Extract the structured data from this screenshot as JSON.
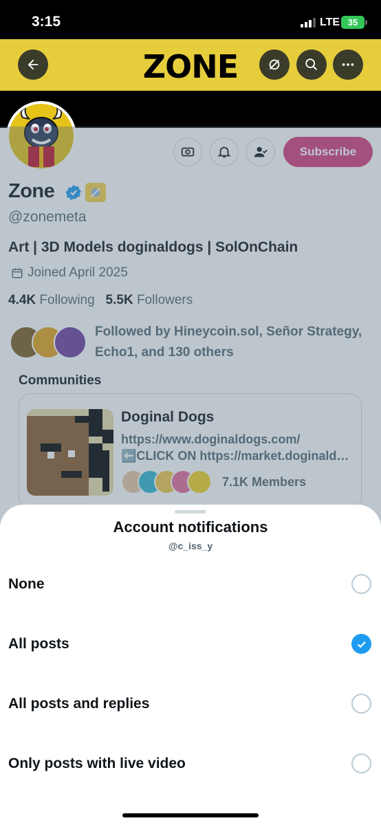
{
  "status_bar": {
    "time": "3:15",
    "network": "LTE",
    "battery": "35"
  },
  "header": {
    "logo": "ZONE",
    "back_icon": "back-arrow-icon",
    "follow_icon": "grok-icon",
    "search_icon": "search-icon",
    "more_icon": "more-icon"
  },
  "profile": {
    "name": "Zone",
    "handle": "@zonemeta",
    "bio": "Art | 3D Models doginaldogs | SolOnChain",
    "joined": "Joined April 2025",
    "following_count": "4.4K",
    "following_label": "Following",
    "followers_count": "5.5K",
    "followers_label": "Followers",
    "followed_by": "Followed by Hineycoin.sol, Señor Strategy, Echo1, and 130 others",
    "subscribe_label": "Subscribe"
  },
  "communities": {
    "label": "Communities",
    "card": {
      "name": "Doginal Dogs",
      "url": "https://www.doginaldogs.com/",
      "description": "⬅️CLICK ON https://market.doginaldogs.com",
      "members": "7.1K Members"
    }
  },
  "sheet": {
    "title": "Account notifications",
    "subtitle": "@c_iss_y",
    "options": [
      {
        "label": "None",
        "selected": false
      },
      {
        "label": "All posts",
        "selected": true
      },
      {
        "label": "All posts and replies",
        "selected": false
      },
      {
        "label": "Only posts with live video",
        "selected": false
      }
    ]
  },
  "colors": {
    "accent": "#1d9bf0",
    "banner": "#e6cd3c",
    "subscribe": "#d63b7c"
  }
}
